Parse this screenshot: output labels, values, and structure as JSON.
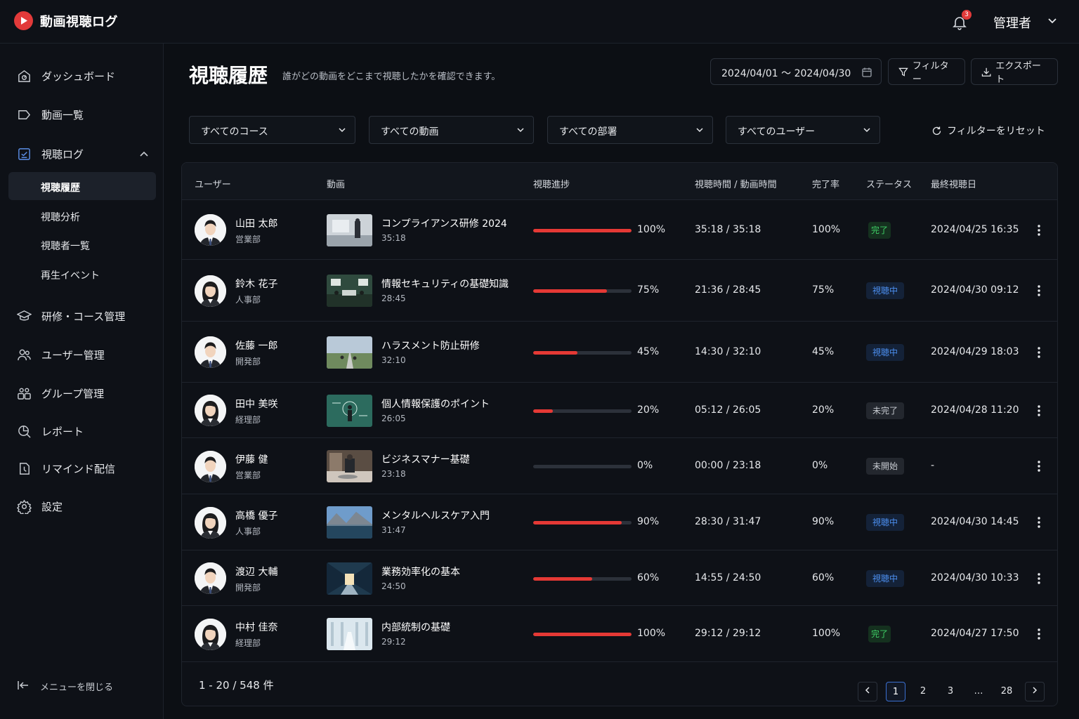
{
  "app": {
    "title": "動画視聴ログ",
    "notifications": "3",
    "user_menu": "管理者"
  },
  "sidebar": {
    "items": [
      {
        "label": "ダッシュボード",
        "icon": "dashboard-icon"
      },
      {
        "label": "動画一覧",
        "icon": "video-icon"
      },
      {
        "label": "視聴ログ",
        "icon": "log-icon"
      },
      {
        "label": "研修・コース管理",
        "icon": "graduation-cap-icon"
      },
      {
        "label": "ユーザー管理",
        "icon": "users-icon"
      },
      {
        "label": "グループ管理",
        "icon": "group-icon"
      },
      {
        "label": "レポート",
        "icon": "report-icon"
      },
      {
        "label": "リマインド配信",
        "icon": "reminder-icon"
      },
      {
        "label": "設定",
        "icon": "gear-icon"
      }
    ],
    "subitems": [
      {
        "label": "視聴履歴",
        "active": true
      },
      {
        "label": "視聴分析"
      },
      {
        "label": "視聴者一覧"
      },
      {
        "label": "再生イベント"
      }
    ],
    "collapse_label": "メニューを閉じる"
  },
  "header": {
    "title": "視聴履歴",
    "description": "誰がどの動画をどこまで視聴したかを確認できます。",
    "date_range": "2024/04/01 〜 2024/04/30",
    "filter_label": "フィルター",
    "export_label": "エクスポート"
  },
  "filters": {
    "course": "すべてのコース",
    "video": "すべての動画",
    "department": "すべての部署",
    "user": "すべてのユーザー",
    "reset": "フィルターをリセット"
  },
  "table": {
    "columns": [
      "ユーザー",
      "動画",
      "視聴進捗",
      "視聴時間 / 動画時間",
      "完了率",
      "ステータス",
      "最終視聴日"
    ],
    "rows": [
      {
        "name": "山田 太郎",
        "dept": "営業部",
        "video": "コンプライアンス研修 2024",
        "duration": "35:18",
        "progress": 100,
        "progress_label": "100%",
        "time": "35:18 / 35:18",
        "rate": "100%",
        "status": "完了",
        "status_type": "done",
        "last": "2024/04/25 16:35",
        "gender": "m",
        "thumb": "office"
      },
      {
        "name": "鈴木 花子",
        "dept": "人事部",
        "video": "情報セキュリティの基礎知識",
        "duration": "28:45",
        "progress": 75,
        "progress_label": "75%",
        "time": "21:36 / 28:45",
        "rate": "75%",
        "status": "視聴中",
        "status_type": "watching",
        "last": "2024/04/30 09:12",
        "gender": "f",
        "thumb": "security"
      },
      {
        "name": "佐藤 一郎",
        "dept": "開発部",
        "video": "ハラスメント防止研修",
        "duration": "32:10",
        "progress": 45,
        "progress_label": "45%",
        "time": "14:30 / 32:10",
        "rate": "45%",
        "status": "視聴中",
        "status_type": "watching",
        "last": "2024/04/29 18:03",
        "gender": "m",
        "thumb": "road"
      },
      {
        "name": "田中 美咲",
        "dept": "経理部",
        "video": "個人情報保護のポイント",
        "duration": "26:05",
        "progress": 20,
        "progress_label": "20%",
        "time": "05:12 / 26:05",
        "rate": "20%",
        "status": "未完了",
        "status_type": "incomplete",
        "last": "2024/04/28 11:20",
        "gender": "f",
        "thumb": "privacy"
      },
      {
        "name": "伊藤 健",
        "dept": "営業部",
        "video": "ビジネスマナー基礎",
        "duration": "23:18",
        "progress": 0,
        "progress_label": "0%",
        "time": "00:00 / 23:18",
        "rate": "0%",
        "status": "未開始",
        "status_type": "incomplete",
        "last": "-",
        "gender": "m",
        "thumb": "desk"
      },
      {
        "name": "高橋 優子",
        "dept": "人事部",
        "video": "メンタルヘルスケア入門",
        "duration": "31:47",
        "progress": 90,
        "progress_label": "90%",
        "time": "28:30 / 31:47",
        "rate": "90%",
        "status": "視聴中",
        "status_type": "watching",
        "last": "2024/04/30 14:45",
        "gender": "f",
        "thumb": "lake"
      },
      {
        "name": "渡辺 大輔",
        "dept": "開発部",
        "video": "業務効率化の基本",
        "duration": "24:50",
        "progress": 60,
        "progress_label": "60%",
        "time": "14:55 / 24:50",
        "rate": "60%",
        "status": "視聴中",
        "status_type": "watching",
        "last": "2024/04/30 10:33",
        "gender": "m",
        "thumb": "corridor"
      },
      {
        "name": "中村 佳奈",
        "dept": "経理部",
        "video": "内部統制の基礎",
        "duration": "29:12",
        "progress": 100,
        "progress_label": "100%",
        "time": "29:12 / 29:12",
        "rate": "100%",
        "status": "完了",
        "status_type": "done",
        "last": "2024/04/27 17:50",
        "gender": "f",
        "thumb": "hall"
      }
    ]
  },
  "pagination": {
    "summary": "1 - 20 / 548 件",
    "pages": [
      "1",
      "2",
      "3",
      "…",
      "28"
    ],
    "current": "1"
  },
  "colors": {
    "accent": "#e53935",
    "done": "#3fcf66",
    "watching": "#4c8ff0",
    "background": "#0c0f14"
  }
}
